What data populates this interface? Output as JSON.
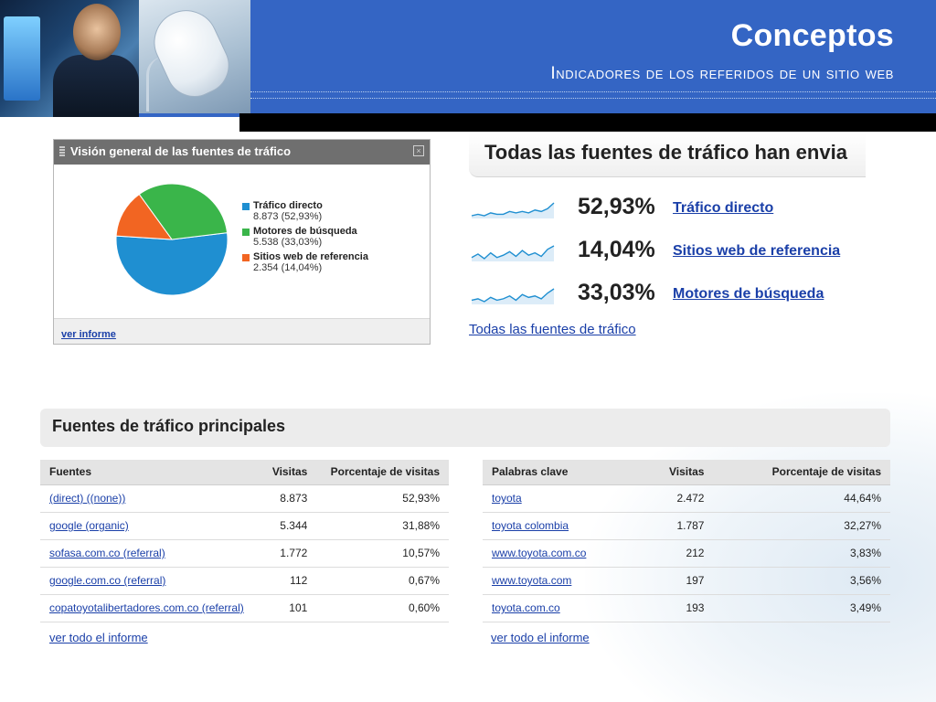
{
  "header": {
    "title": "Conceptos",
    "subtitle": "Indicadores de los referidos de un sitio web"
  },
  "overview_widget": {
    "title": "Visión general de las fuentes de tráfico",
    "close_glyph": "×",
    "report_link": "ver informe",
    "chart_data": {
      "type": "pie",
      "slices": [
        {
          "label": "Tráfico directo",
          "value": 8873,
          "display": "8.873 (52,93%)",
          "percent": 52.93,
          "color": "#1f8fd1"
        },
        {
          "label": "Motores de búsqueda",
          "value": 5538,
          "display": "5.538 (33,03%)",
          "percent": 33.03,
          "color": "#3ab54a"
        },
        {
          "label": "Sitios web de referencia",
          "value": 2354,
          "display": "2.354 (14,04%)",
          "percent": 14.04,
          "color": "#f26522"
        }
      ]
    }
  },
  "sources_panel": {
    "heading": "Todas las fuentes de tráfico han envia",
    "rows": [
      {
        "percent": "52,93%",
        "label": "Tráfico directo",
        "trend": [
          5,
          6,
          5,
          7,
          6,
          6,
          8,
          7,
          8,
          7,
          9,
          8,
          10,
          14
        ]
      },
      {
        "percent": "14,04%",
        "label": "Sitios web de referencia",
        "trend": [
          6,
          9,
          5,
          10,
          6,
          8,
          11,
          7,
          12,
          8,
          10,
          7,
          13,
          16
        ]
      },
      {
        "percent": "33,03%",
        "label": "Motores de búsqueda",
        "trend": [
          7,
          8,
          6,
          9,
          7,
          8,
          10,
          7,
          11,
          9,
          10,
          8,
          12,
          15
        ]
      }
    ],
    "all_link": "Todas las fuentes de tráfico"
  },
  "top_sources": {
    "section_title": "Fuentes de tráfico principales",
    "sources_table": {
      "headers": [
        "Fuentes",
        "Visitas",
        "Porcentaje de visitas"
      ],
      "rows": [
        [
          "(direct) ((none))",
          "8.873",
          "52,93%"
        ],
        [
          "google (organic)",
          "5.344",
          "31,88%"
        ],
        [
          "sofasa.com.co (referral)",
          "1.772",
          "10,57%"
        ],
        [
          "google.com.co (referral)",
          "112",
          "0,67%"
        ],
        [
          "copatoyotalibertadores.com.co (referral)",
          "101",
          "0,60%"
        ]
      ],
      "footer_link": "ver todo el informe"
    },
    "keywords_table": {
      "headers": [
        "Palabras clave",
        "Visitas",
        "Porcentaje de visitas"
      ],
      "rows": [
        [
          "toyota",
          "2.472",
          "44,64%"
        ],
        [
          "toyota colombia",
          "1.787",
          "32,27%"
        ],
        [
          "www.toyota.com.co",
          "212",
          "3,83%"
        ],
        [
          "www.toyota.com",
          "197",
          "3,56%"
        ],
        [
          "toyota.com.co",
          "193",
          "3,49%"
        ]
      ],
      "footer_link": "ver todo el informe"
    }
  },
  "colors": {
    "banner": "#3465c4",
    "link": "#1a3fa8",
    "sparkline": "#1f8fd1"
  }
}
